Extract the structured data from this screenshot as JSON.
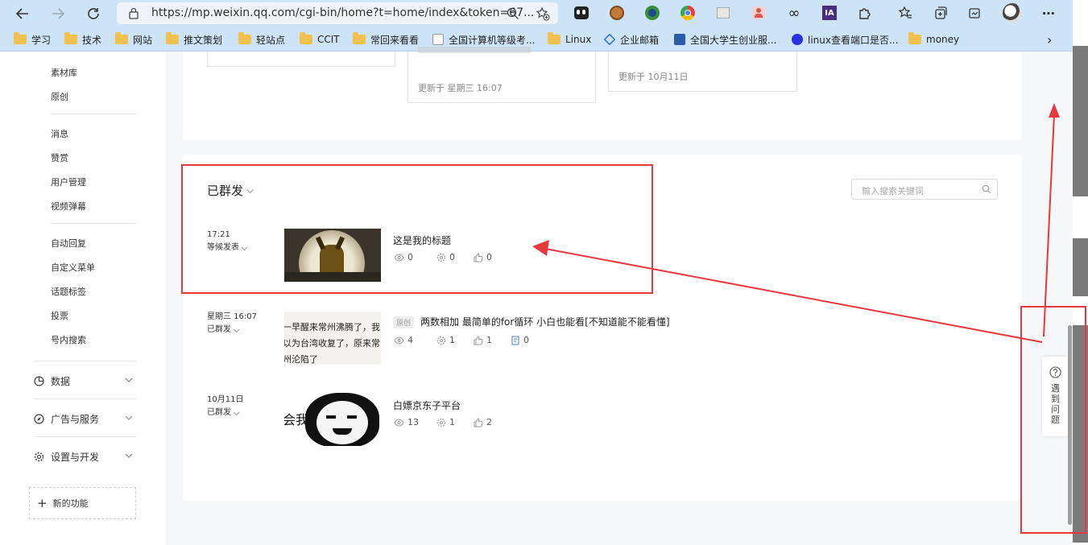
{
  "browser": {
    "url": "https://mp.weixin.qq.com/cgi-bin/home?t=home/index&token=67...",
    "bookmarks": [
      "学习",
      "技术",
      "网站",
      "推文策划",
      "轻站点",
      "CCIT",
      "常回来看看",
      "全国计算机等级考...",
      "Linux",
      "企业邮箱",
      "全国大学生创业服...",
      "linux查看端口是否...",
      "money"
    ]
  },
  "sidebar": {
    "items_top": [
      "素材库",
      "原创"
    ],
    "items_mid": [
      "消息",
      "赞赏",
      "用户管理",
      "视频弹幕"
    ],
    "items_auto": [
      "自动回复",
      "自定义菜单",
      "话题标签",
      "投票",
      "号内搜索"
    ],
    "groups": [
      "数据",
      "广告与服务",
      "设置与开发"
    ],
    "new_feature": "新的功能"
  },
  "top_cards": [
    {
      "updated": "更新于 星期三 16:07"
    },
    {
      "updated": "更新于 10月11日"
    }
  ],
  "section": {
    "title": "已群发",
    "search_placeholder": "输入搜索关键词"
  },
  "articles": [
    {
      "date": "17:21",
      "status": "等候发表",
      "title": "这是我的标题",
      "views": "0",
      "shares": "0",
      "likes": "0"
    },
    {
      "date": "星期三 16:07",
      "status": "已群发",
      "tag": "原创",
      "title": "两数相加 最简单的for循环 小白也能看[不知道能不能看懂]",
      "views": "4",
      "shares": "1",
      "likes": "1",
      "comments": "0",
      "thumb_lines": [
        "一早醒来常州沸腾了，我",
        "以为台湾收复了，原来常",
        "州沦陷了"
      ]
    },
    {
      "date": "10月11日",
      "status": "已群发",
      "title": "白嫖京东子平台",
      "views": "13",
      "shares": "1",
      "likes": "2",
      "thumb_text": "会我"
    }
  ],
  "help": {
    "label": "遇到问题"
  },
  "colors": {
    "annotation": "#e8383d",
    "chrome": "#cde4f7"
  }
}
